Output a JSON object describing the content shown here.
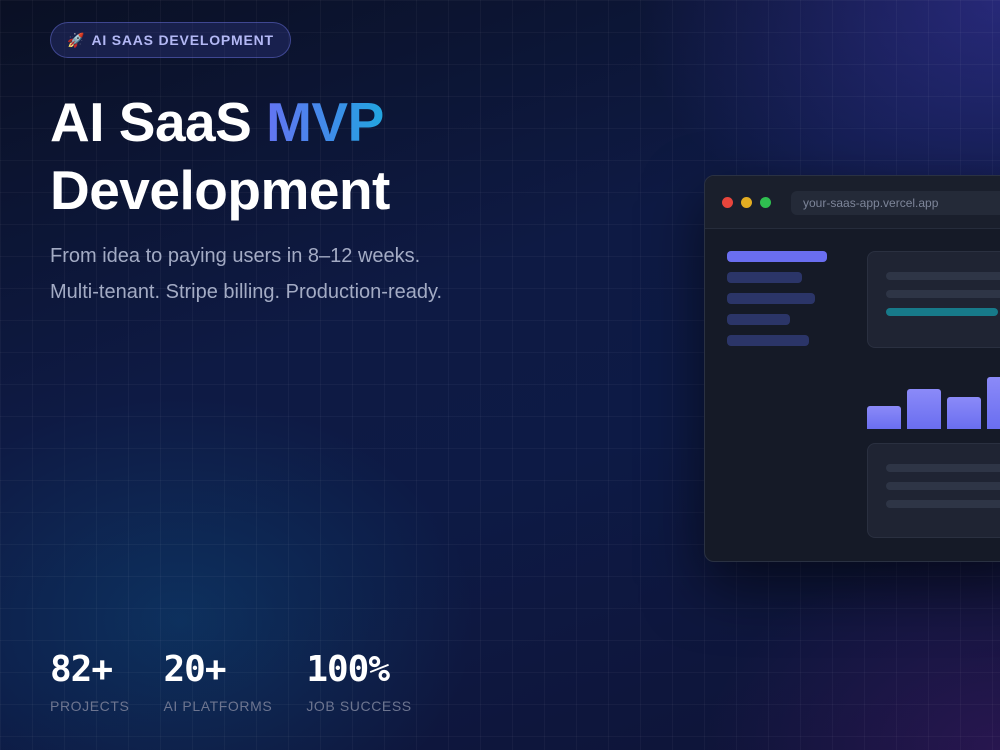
{
  "badge": {
    "icon": "rocket-icon",
    "icon_glyph": "🚀",
    "label": "AI SAAS DEVELOPMENT"
  },
  "headline": {
    "text_before": "AI SaaS ",
    "accent": "MVP",
    "line2": "Development"
  },
  "subtitle": {
    "line1": "From idea to paying users in 8–12 weeks.",
    "line2": "Multi-tenant. Stripe billing. Production-ready."
  },
  "stats": [
    {
      "value": "82+",
      "label": "PROJECTS"
    },
    {
      "value": "20+",
      "label": "AI PLATFORMS"
    },
    {
      "value": "100%",
      "label": "JOB SUCCESS"
    }
  ],
  "browser": {
    "url": "your-saas-app.vercel.app",
    "window_dots": [
      "close-dot",
      "minimize-dot",
      "maximize-dot"
    ],
    "dot_colors": {
      "red": "#e8453c",
      "yellow": "#e3ad22",
      "green": "#2fbf50"
    }
  },
  "colors": {
    "accent_indigo": "#6a6ef0",
    "accent_blue": "#3b8fe8",
    "accent_teal": "#177a8a",
    "background": "#0b1430"
  }
}
